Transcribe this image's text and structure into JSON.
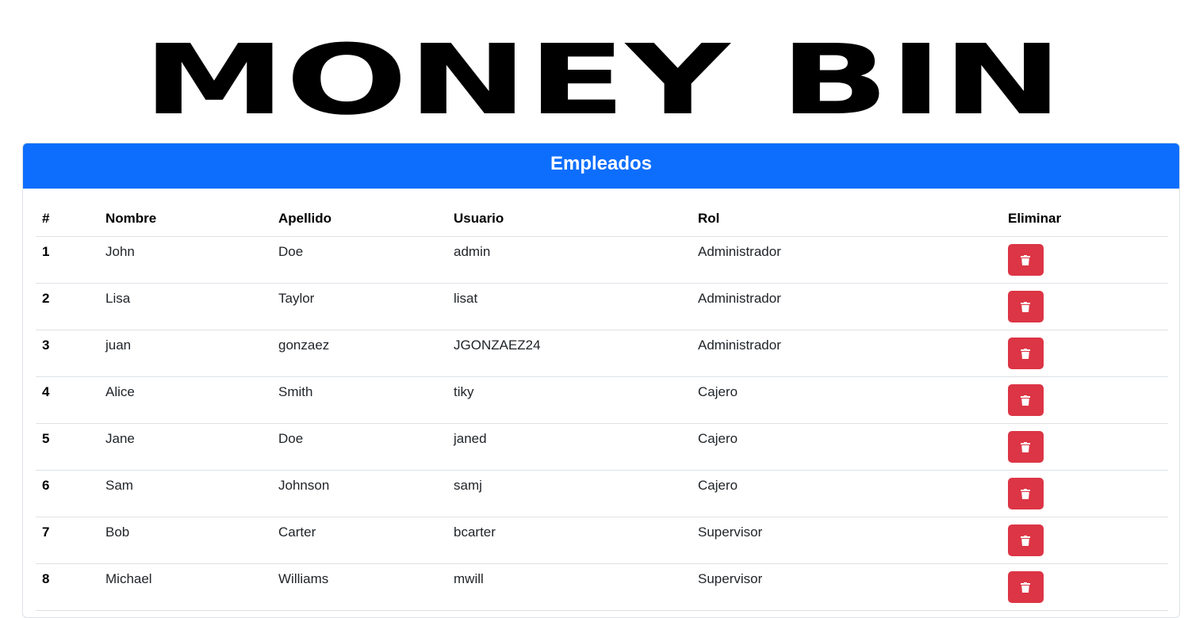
{
  "logo": {
    "text": "MONEY BIN"
  },
  "card": {
    "title": "Empleados"
  },
  "table": {
    "headers": {
      "num": "#",
      "nombre": "Nombre",
      "apellido": "Apellido",
      "usuario": "Usuario",
      "rol": "Rol",
      "eliminar": "Eliminar"
    },
    "rows": [
      {
        "num": "1",
        "nombre": "John",
        "apellido": "Doe",
        "usuario": "admin",
        "rol": "Administrador"
      },
      {
        "num": "2",
        "nombre": "Lisa",
        "apellido": "Taylor",
        "usuario": "lisat",
        "rol": "Administrador"
      },
      {
        "num": "3",
        "nombre": "juan",
        "apellido": "gonzaez",
        "usuario": "JGONZAEZ24",
        "rol": "Administrador"
      },
      {
        "num": "4",
        "nombre": "Alice",
        "apellido": "Smith",
        "usuario": "tiky",
        "rol": "Cajero"
      },
      {
        "num": "5",
        "nombre": "Jane",
        "apellido": "Doe",
        "usuario": "janed",
        "rol": "Cajero"
      },
      {
        "num": "6",
        "nombre": "Sam",
        "apellido": "Johnson",
        "usuario": "samj",
        "rol": "Cajero"
      },
      {
        "num": "7",
        "nombre": "Bob",
        "apellido": "Carter",
        "usuario": "bcarter",
        "rol": "Supervisor"
      },
      {
        "num": "8",
        "nombre": "Michael",
        "apellido": "Williams",
        "usuario": "mwill",
        "rol": "Supervisor"
      }
    ],
    "delete_icon": "trash-icon"
  },
  "colors": {
    "header_bg": "#0d6efd",
    "delete_bg": "#dc3545"
  }
}
